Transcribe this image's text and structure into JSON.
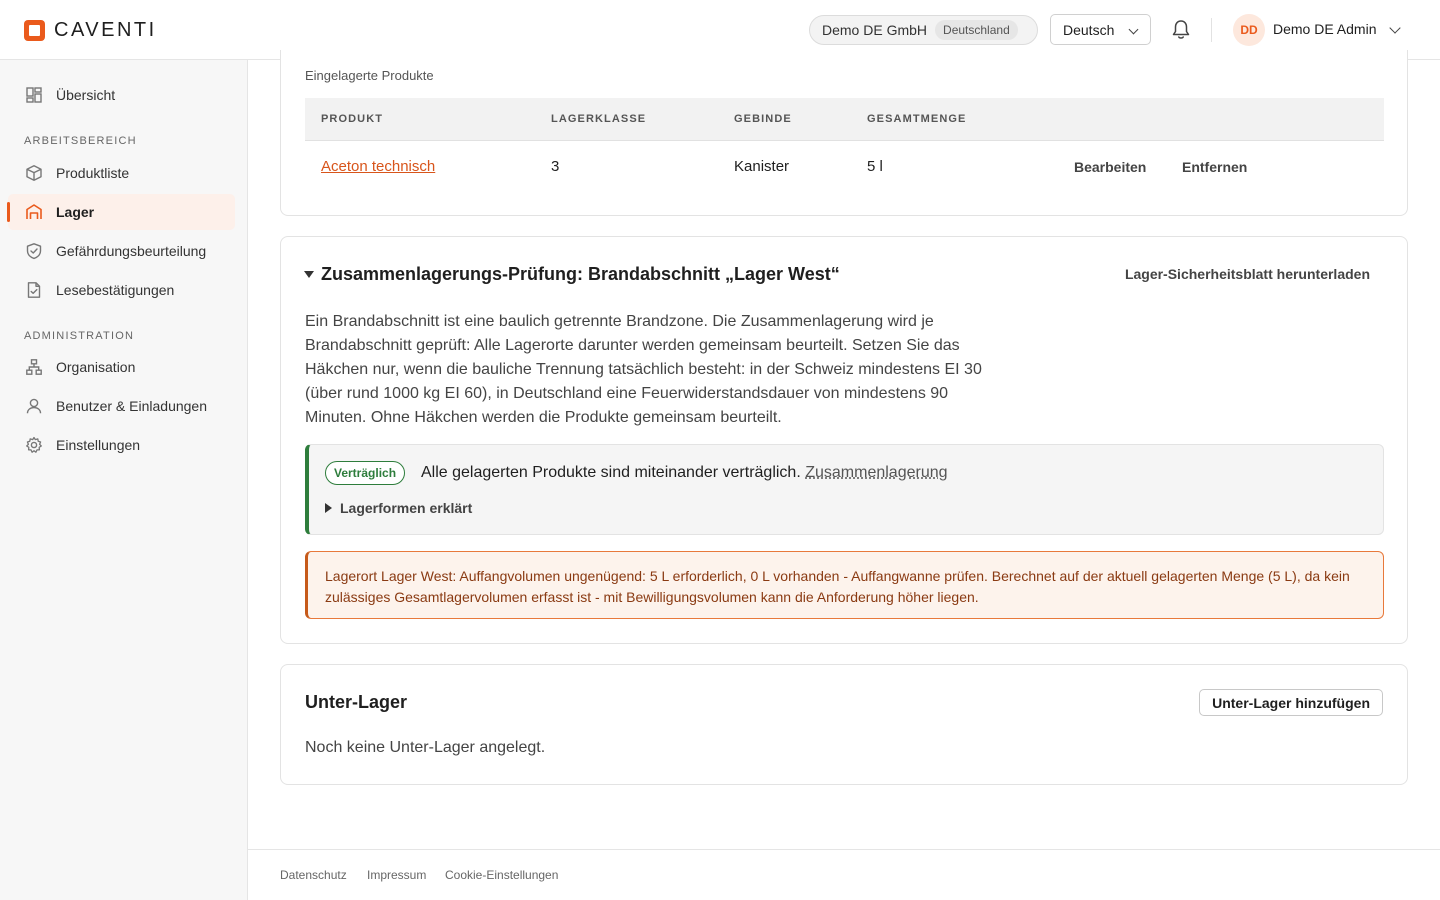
{
  "brand": {
    "name": "CAVENTI",
    "accent": "#ea5a1c"
  },
  "header": {
    "org_name": "Demo DE GmbH",
    "org_country": "Deutschland",
    "language": "Deutsch",
    "avatar_initials": "DD",
    "user_name": "Demo DE Admin"
  },
  "sidebar": {
    "overview": "Übersicht",
    "section_work": "ARBEITSBEREICH",
    "items_work": [
      "Produktliste",
      "Lager",
      "Gefährdungsbeurteilung",
      "Lesebestätigungen"
    ],
    "active_item": "Lager",
    "section_admin": "ADMINISTRATION",
    "items_admin": [
      "Organisation",
      "Benutzer & Einladungen",
      "Einstellungen"
    ]
  },
  "stored_products": {
    "label": "Eingelagerte Produkte",
    "columns": [
      "PRODUKT",
      "LAGERKLASSE",
      "GEBINDE",
      "GESAMTMENGE"
    ],
    "rows": [
      {
        "product": "Aceton technisch",
        "storage_class": "3",
        "container": "Kanister",
        "total": "5 l",
        "edit": "Bearbeiten",
        "remove": "Entfernen"
      }
    ]
  },
  "compat_check": {
    "title": "Zusammenlagerungs-Prüfung: Brandabschnitt „Lager West“",
    "download": "Lager-Sicherheitsblatt herunterladen",
    "description": "Ein Brandabschnitt ist eine baulich getrennte Brandzone. Die Zusammenlagerung wird je Brandabschnitt geprüft: Alle Lagerorte darunter werden gemeinsam beurteilt. Setzen Sie das Häkchen nur, wenn die bauliche Trennung tatsächlich besteht: in der Schweiz mindestens EI 30 (über rund 1000 kg EI 60), in Deutschland eine Feuerwiderstandsdauer von mindestens 90 Minuten. Ohne Häkchen werden die Produkte gemeinsam beurteilt.",
    "badge": "Verträglich",
    "result": "Alle gelagerten Produkte sind miteinander verträglich.",
    "result_link": "Zusammenlagerung",
    "details": "Lagerformen erklärt",
    "warning": "Lagerort Lager West: Auffangvolumen ungenügend: 5 L erforderlich, 0 L vorhanden - Auffangwanne prüfen. Berechnet auf der aktuell gelagerten Menge (5 L), da kein zulässiges Gesamtlagervolumen erfasst ist - mit Bewilligungsvolumen kann die Anforderung höher liegen."
  },
  "sub_storage": {
    "title": "Unter-Lager",
    "add_button": "Unter-Lager hinzufügen",
    "empty": "Noch keine Unter-Lager angelegt."
  },
  "footer": {
    "links": [
      "Datenschutz",
      "Impressum",
      "Cookie-Einstellungen"
    ]
  }
}
